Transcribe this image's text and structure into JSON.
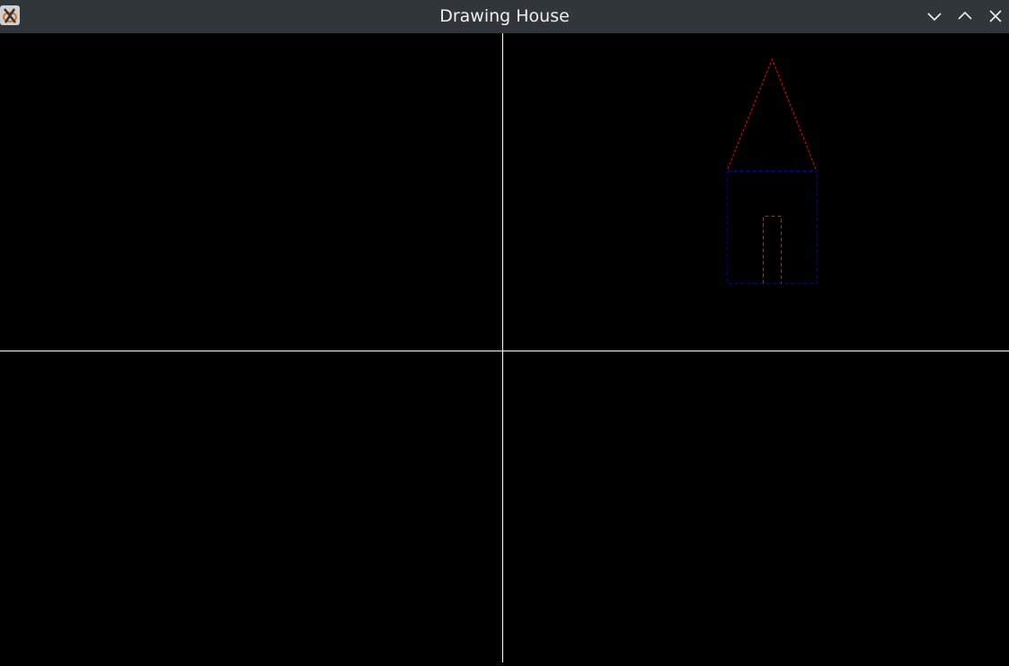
{
  "window": {
    "title": "Drawing House",
    "icons": [
      "app-icon",
      "minimize-icon",
      "maximize-icon",
      "close-icon"
    ]
  },
  "colors": {
    "titlebar": "#31363b",
    "roof": "#ff0000",
    "wall_top": "#0000ff",
    "walls": "#0000cc",
    "door": "#8b4513",
    "divider": "#ffffff"
  }
}
